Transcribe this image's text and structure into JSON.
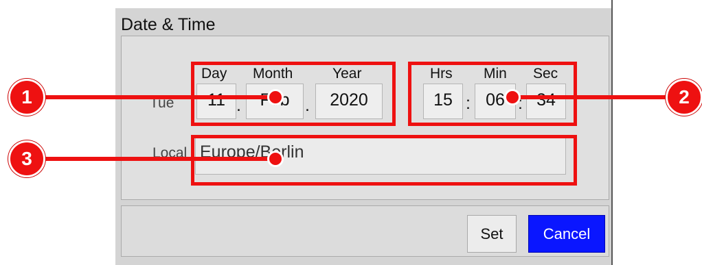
{
  "dialog": {
    "title": "Date & Time",
    "weekday": "Tue",
    "date_headers": {
      "day": "Day",
      "month": "Month",
      "year": "Year"
    },
    "date": {
      "day": "11",
      "month": "Feb",
      "year": "2020",
      "separator": "."
    },
    "time_headers": {
      "hours": "Hrs",
      "minutes": "Min",
      "seconds": "Sec"
    },
    "time": {
      "hours": "15",
      "minutes": "06",
      "seconds": "34",
      "separator": ":"
    },
    "locale_label": "Local",
    "timezone": "Europe/Berlin"
  },
  "buttons": {
    "set": "Set",
    "cancel": "Cancel"
  },
  "callouts": {
    "one": "1",
    "two": "2",
    "three": "3"
  },
  "colors": {
    "callout": "#ee1111",
    "cancel_bg": "#0a16ff"
  }
}
